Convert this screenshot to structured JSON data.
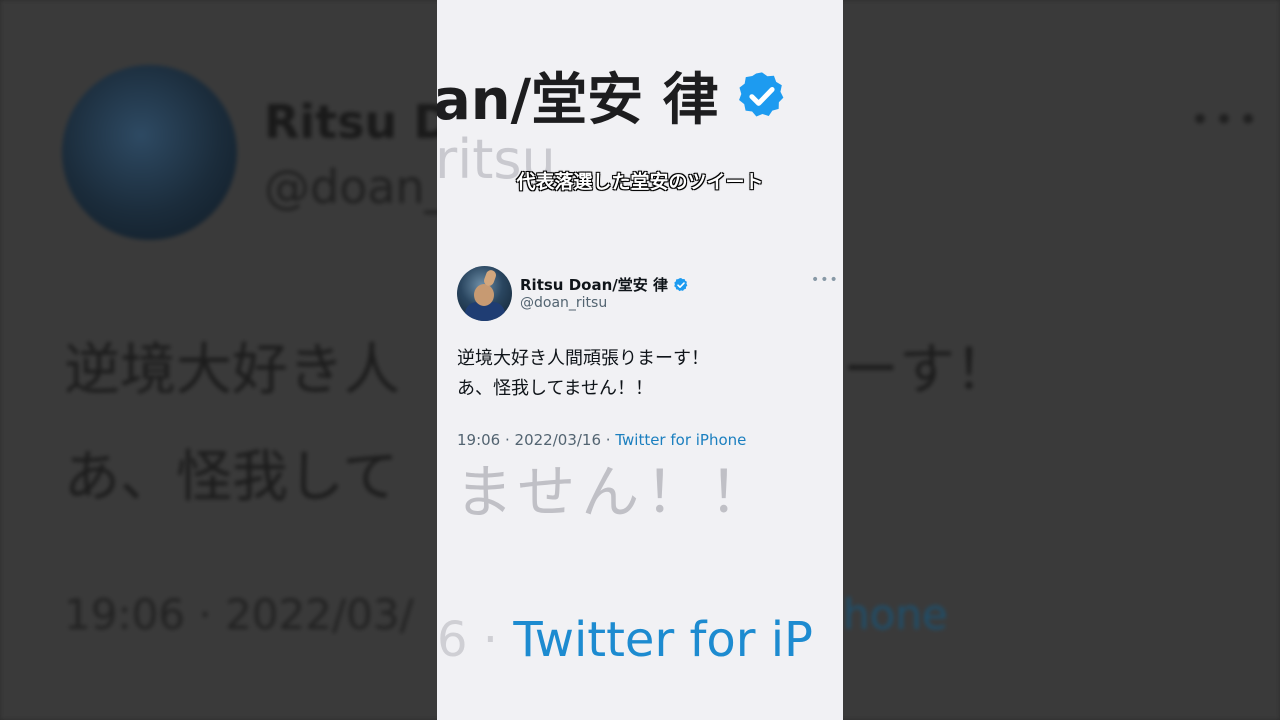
{
  "caption": "代表落選した堂安のツイート",
  "tweet": {
    "display_name": "Ritsu Doan/堂安 律",
    "handle": "@doan_ritsu",
    "body_line1": "逆境大好き人間頑張りまーす！",
    "body_line2": "あ、怪我してません！！",
    "time": "19:06",
    "separator": " · ",
    "date": "2022/03/16",
    "source": "Twitter for iPhone",
    "more_icon": "more-horizontal-icon",
    "verified_icon": "verified-badge-icon"
  },
  "background": {
    "name_fragment": "Ritsu Do",
    "handle_fragment": "@doan_",
    "line1_fragment": "逆境大好き人",
    "line1_right_fragment": "ーす！",
    "line2_fragment": "あ、怪我して",
    "meta_fragment": "19:06 · 2022/03/",
    "source_fragment": "hone",
    "more": "•••"
  },
  "zoomed": {
    "name_fragment": "an/堂安 律",
    "handle_fragment": "ritsu",
    "body_fragment": "ません！！",
    "meta_date_fragment": "6 · ",
    "meta_source_fragment": "Twitter for iP"
  },
  "colors": {
    "verified_blue": "#1d9bf0",
    "link_blue": "#1b7fbf",
    "handle_gray": "#536471"
  }
}
